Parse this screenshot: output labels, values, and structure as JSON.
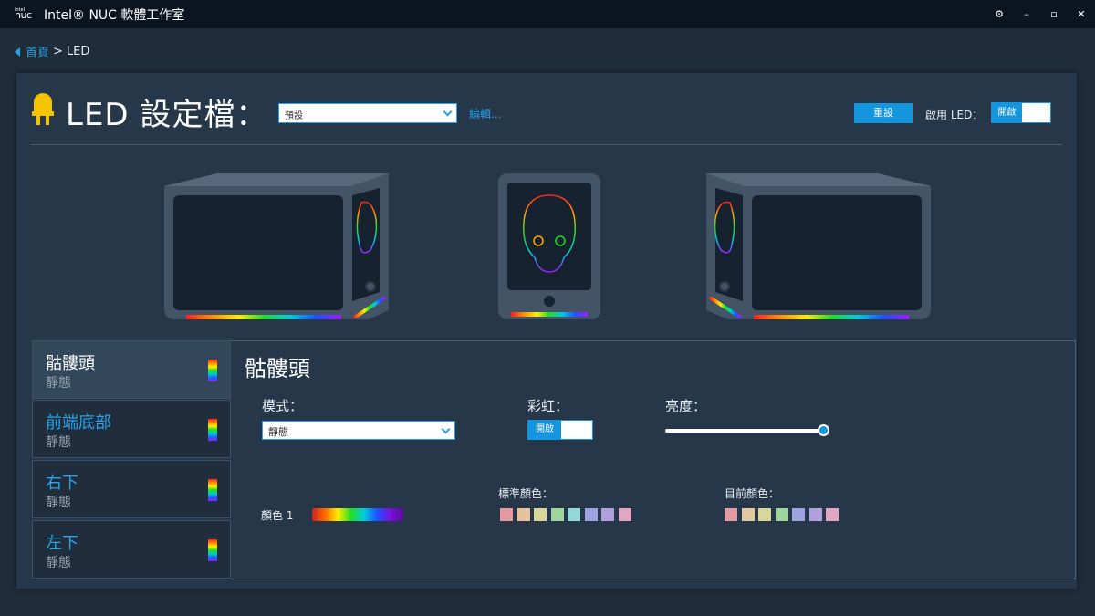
{
  "app": {
    "logo_top": "intel",
    "logo_bottom": "nuc",
    "title": "Intel® NUC 軟體工作室",
    "window_buttons": {
      "settings": "⚙",
      "minimize": "–",
      "maximize": "▫",
      "close": "✕"
    }
  },
  "breadcrumb": {
    "home": "首頁",
    "separator": ">",
    "current": "LED"
  },
  "header": {
    "title": "LED 設定檔：",
    "profile_value": "預設",
    "edit_link": "編輯...",
    "reset_label": "重設",
    "enable_label": "啟用 LED：",
    "enable_toggle": "開啟"
  },
  "zones": [
    {
      "name": "骷髏頭",
      "state": "靜態",
      "selected": true
    },
    {
      "name": "前端底部",
      "state": "靜態",
      "selected": false
    },
    {
      "name": "右下",
      "state": "靜態",
      "selected": false
    },
    {
      "name": "左下",
      "state": "靜態",
      "selected": false
    }
  ],
  "detail": {
    "title": "骷髏頭",
    "mode_label": "模式：",
    "mode_value": "靜態",
    "rainbow_label": "彩虹：",
    "rainbow_toggle": "開啟",
    "brightness_label": "亮度：",
    "brightness_level": 1.0,
    "color1_label": "顏色 1",
    "standard_colors_label": "標準顏色：",
    "standard_colors": [
      "#e39aa0",
      "#e8c09c",
      "#d9d69a",
      "#9fd69b",
      "#93d9dc",
      "#9ea3e0",
      "#b29fdd",
      "#e2a6c2"
    ],
    "current_colors_label": "目前顏色：",
    "current_colors": [
      "#e39aa0",
      "#e2c8a0",
      "#d9d69a",
      "#9fd69b",
      "#9ea3e0",
      "#b29fdd",
      "#e2a6c2"
    ]
  },
  "colors": {
    "accent": "#1496de",
    "panel": "#263749",
    "background": "#1f2c3a"
  }
}
